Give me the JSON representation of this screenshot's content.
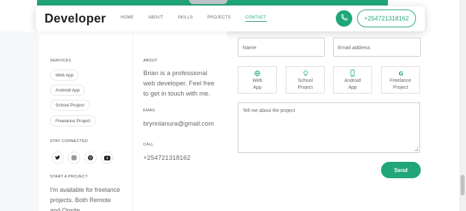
{
  "navbar": {
    "brand": "Developer",
    "links": [
      "HOME",
      "ABOUT",
      "SKILLS",
      "PROJECTS",
      "CONTACT"
    ],
    "active_link": "CONTACT",
    "phone": "+254721318162"
  },
  "sidebar": {
    "services_label": "SERVICES",
    "services": [
      "Web App",
      "Android App",
      "School Project",
      "Freelance Project"
    ],
    "stay_connected_label": "STAY CONNECTED",
    "social_icons": [
      "twitter-icon",
      "instagram-icon",
      "pinterest-icon",
      "youtube-icon"
    ],
    "start_project_label": "START A PROJECT",
    "start_project_text_1": "I'm available for freelance",
    "start_project_text_2": "projects. Both Remote",
    "start_project_text_3": "and Onsite"
  },
  "about": {
    "about_label": "ABOUT",
    "about_line_1": "Brian is a professional",
    "about_line_2": "web developer. Feel free",
    "about_line_3": "to get in touch with me.",
    "email_label": "EMAIL",
    "email": "brynnlanura@gmail.com",
    "call_label": "CALL",
    "phone": "+254721318162"
  },
  "form": {
    "name_placeholder": "Name",
    "email_placeholder": "Email address",
    "service_options": [
      {
        "line1": "Web",
        "line2": "App",
        "icon": "globe-icon"
      },
      {
        "line1": "School",
        "line2": "Project",
        "icon": "lightbulb-icon"
      },
      {
        "line1": "Android",
        "line2": "App",
        "icon": "smartphone-icon"
      },
      {
        "line1": "Freelance",
        "line2": "Project",
        "icon": "google-icon"
      }
    ],
    "message_placeholder": "Tell me about the project",
    "send_label": "Send"
  },
  "colors": {
    "accent": "#20a67a"
  }
}
